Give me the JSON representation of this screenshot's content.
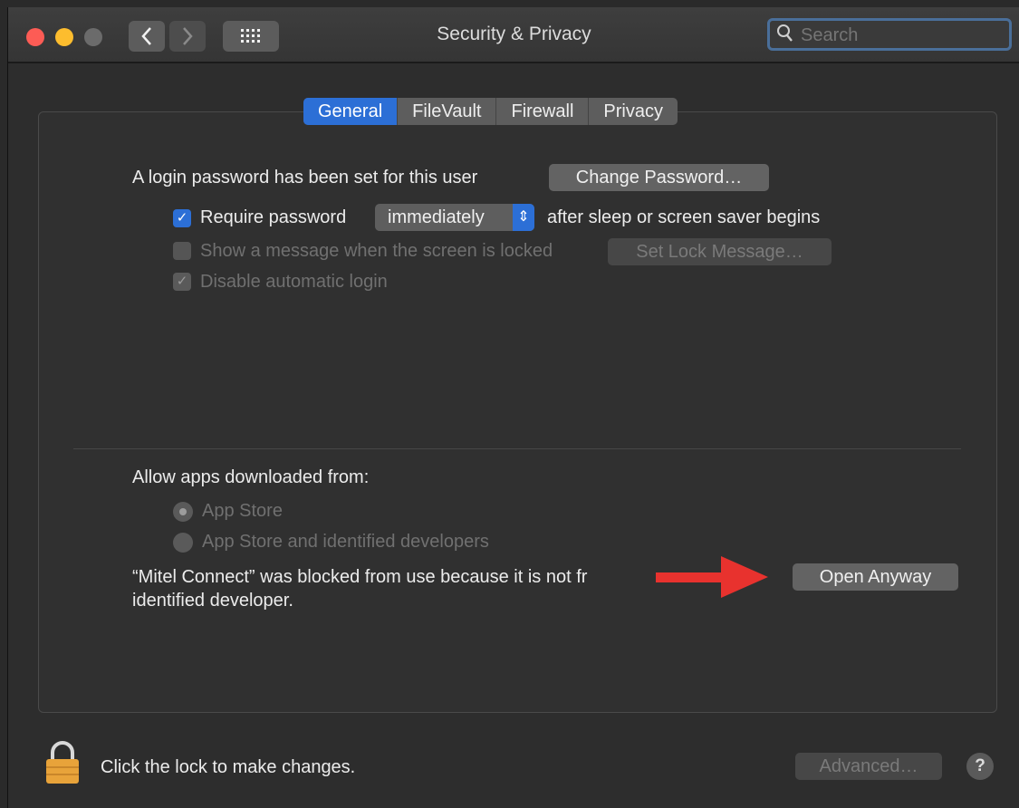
{
  "window": {
    "title": "Security & Privacy"
  },
  "toolbar": {
    "back_icon": "chevron-left-icon",
    "forward_icon": "chevron-right-icon",
    "grid_icon": "grid-icon",
    "search_placeholder": "Search"
  },
  "tabs": [
    {
      "label": "General",
      "active": true
    },
    {
      "label": "FileVault",
      "active": false
    },
    {
      "label": "Firewall",
      "active": false
    },
    {
      "label": "Privacy",
      "active": false
    }
  ],
  "general": {
    "login_text": "A login password has been set for this user",
    "change_password_label": "Change Password…",
    "require_password_label": "Require password",
    "require_password_checked": true,
    "require_password_value": "immediately",
    "require_password_suffix": "after sleep or screen saver begins",
    "show_message_label": "Show a message when the screen is locked",
    "show_message_checked": false,
    "set_lock_message_label": "Set Lock Message…",
    "disable_autologin_label": "Disable automatic login",
    "disable_autologin_checked": true
  },
  "apps": {
    "heading": "Allow apps downloaded from:",
    "option_app_store": "App Store",
    "option_identified": "App Store and identified developers",
    "selected": "App Store",
    "blocked_line1": "“Mitel Connect” was blocked from use because it is not fr",
    "blocked_line2": "identified developer.",
    "open_anyway_label": "Open Anyway"
  },
  "footer": {
    "lock_text": "Click the lock to make changes.",
    "advanced_label": "Advanced…",
    "help_label": "?"
  },
  "colors": {
    "accent": "#2c6fd6",
    "annotation_arrow": "#e8322e",
    "lock": "#e8a33a"
  }
}
